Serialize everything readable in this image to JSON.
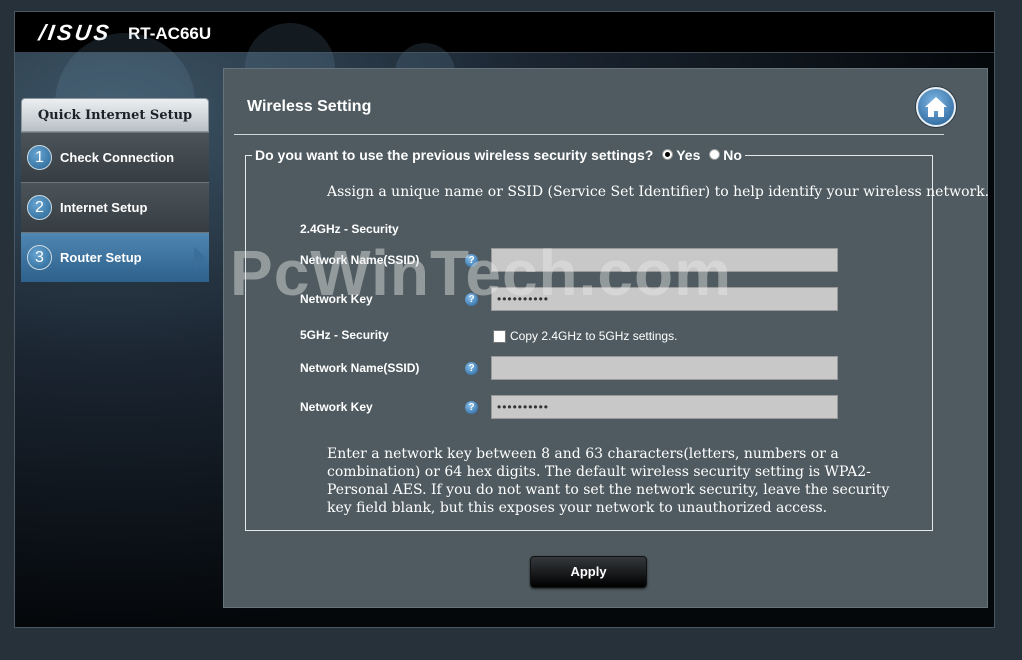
{
  "header": {
    "brand": "/ISUS",
    "model": "RT-AC66U"
  },
  "sidebar": {
    "title": "Quick Internet Setup",
    "steps": [
      {
        "num": "1",
        "label": "Check Connection"
      },
      {
        "num": "2",
        "label": "Internet Setup"
      },
      {
        "num": "3",
        "label": "Router Setup",
        "active": true
      }
    ]
  },
  "content": {
    "title": "Wireless Setting",
    "question": "Do you want to use the previous wireless security settings?",
    "yes_label": "Yes",
    "no_label": "No",
    "selected": "Yes",
    "intro": "Assign a unique name or SSID (Service Set Identifier) to help identify your wireless network.",
    "band24": {
      "section": "2.4GHz - Security",
      "ssid_label": "Network Name(SSID)",
      "ssid_value": "",
      "key_label": "Network Key",
      "key_value": "••••••••••"
    },
    "band5": {
      "section": "5GHz - Security",
      "copy_label": "Copy 2.4GHz to 5GHz settings.",
      "copy_checked": false,
      "ssid_label": "Network Name(SSID)",
      "ssid_value": "",
      "key_label": "Network Key",
      "key_value": "••••••••••"
    },
    "help_glyph": "?",
    "note": "Enter a network key between 8 and 63 characters(letters, numbers or a combination) or 64 hex digits. The default wireless security setting is WPA2-Personal AES. If you do not want to set the network security, leave the security key field blank, but this exposes your network to unauthorized access.",
    "apply_label": "Apply"
  },
  "watermark": "PcWinTech.com",
  "colors": {
    "accent": "#2e618c",
    "panel": "#4f5b60",
    "background": "#000000"
  }
}
